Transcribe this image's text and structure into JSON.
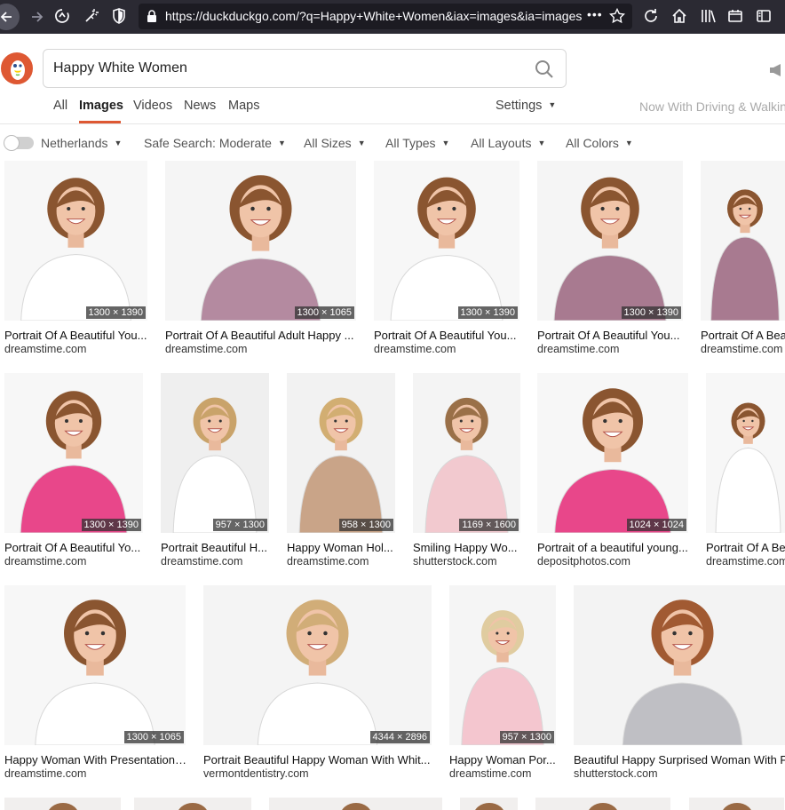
{
  "browser": {
    "url": "https://duckduckgo.com/?q=Happy+White+Women&iax=images&ia=images",
    "url_dots": "•••"
  },
  "search": {
    "query": "Happy White Women"
  },
  "tabs": [
    {
      "label": "All"
    },
    {
      "label": "Images"
    },
    {
      "label": "Videos"
    },
    {
      "label": "News"
    },
    {
      "label": "Maps"
    }
  ],
  "settings_label": "Settings",
  "promo_text": "Now With Driving & Walking",
  "filters": {
    "region": "Netherlands",
    "safe_search": "Safe Search: Moderate",
    "size": "All Sizes",
    "type": "All Types",
    "layout": "All Layouts",
    "color": "All Colors"
  },
  "results": [
    {
      "title": "Portrait Of A Beautiful You...",
      "source": "dreamstime.com",
      "dims": "1300 × 1390",
      "shirt": "#ffffff",
      "hair": "#8a5530",
      "bg": "#f7f7f7"
    },
    {
      "title": "Portrait Of A Beautiful Adult Happy ...",
      "source": "dreamstime.com",
      "dims": "1300 × 1065",
      "shirt": "#b48aa0",
      "hair": "#8a5530",
      "bg": "#f5f5f5"
    },
    {
      "title": "Portrait Of A Beautiful You...",
      "source": "dreamstime.com",
      "dims": "1300 × 1390",
      "shirt": "#ffffff",
      "hair": "#8a5530",
      "bg": "#f7f7f7"
    },
    {
      "title": "Portrait Of A Beautiful You...",
      "source": "dreamstime.com",
      "dims": "1300 × 1390",
      "shirt": "#a87a90",
      "hair": "#8a5530",
      "bg": "#f5f5f5"
    },
    {
      "title": "Portrait Of A Bea",
      "source": "dreamstime.com",
      "dims": "",
      "shirt": "#a87a90",
      "hair": "#8a5530",
      "bg": "#f5f5f5"
    },
    {
      "title": "Portrait Of A Beautiful Yo...",
      "source": "dreamstime.com",
      "dims": "1300 × 1390",
      "shirt": "#e8478a",
      "hair": "#8a5530",
      "bg": "#f7f7f7"
    },
    {
      "title": "Portrait Beautiful H...",
      "source": "dreamstime.com",
      "dims": "957 × 1300",
      "shirt": "#ffffff",
      "hair": "#c9a36a",
      "bg": "#efefef"
    },
    {
      "title": "Happy Woman Hol...",
      "source": "dreamstime.com",
      "dims": "958 × 1300",
      "shirt": "#c9a488",
      "hair": "#d2ae72",
      "bg": "#f2f2f2"
    },
    {
      "title": "Smiling Happy Wo...",
      "source": "shutterstock.com",
      "dims": "1169 × 1600",
      "shirt": "#f2c9cf",
      "hair": "#9a7048",
      "bg": "#f4f4f4"
    },
    {
      "title": "Portrait of a beautiful young...",
      "source": "depositphotos.com",
      "dims": "1024 × 1024",
      "shirt": "#e8478a",
      "hair": "#8a5530",
      "bg": "#f7f7f7"
    },
    {
      "title": "Portrait Of A Be",
      "source": "dreamstime.com",
      "dims": "",
      "shirt": "#ffffff",
      "hair": "#8a5530",
      "bg": "#f7f7f7"
    },
    {
      "title": "Happy Woman With Presentation ...",
      "source": "dreamstime.com",
      "dims": "1300 × 1065",
      "shirt": "#ffffff",
      "hair": "#8a5530",
      "bg": "#f7f7f7"
    },
    {
      "title": "Portrait Beautiful Happy Woman With Whit...",
      "source": "vermontdentistry.com",
      "dims": "4344 × 2896",
      "shirt": "#ffffff",
      "hair": "#d1ad78",
      "bg": "#f4f4f4"
    },
    {
      "title": "Happy Woman Por...",
      "source": "dreamstime.com",
      "dims": "957 × 1300",
      "shirt": "#f4c6cf",
      "hair": "#e0cca0",
      "bg": "#f5f5f5"
    },
    {
      "title": "Beautiful Happy Surprised Woman With P",
      "source": "shutterstock.com",
      "dims": "",
      "shirt": "#bfbfc4",
      "hair": "#a15a32",
      "bg": "#f3f3f3"
    }
  ]
}
